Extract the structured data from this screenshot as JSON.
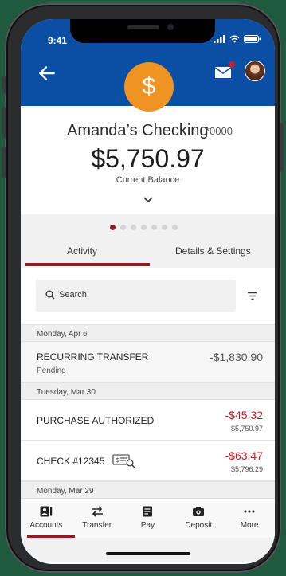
{
  "status": {
    "time": "9:41"
  },
  "account": {
    "name": "Amanda’s Checking",
    "number": "*0000",
    "balance": "$5,750.97",
    "balance_label": "Current Balance"
  },
  "pager": {
    "count": 7,
    "active": 0
  },
  "tabs": [
    {
      "label": "Activity",
      "active": true
    },
    {
      "label": "Details & Settings",
      "active": false
    }
  ],
  "search": {
    "placeholder": "Search"
  },
  "dates": [
    "Monday, Apr 6",
    "Tuesday, Mar 30",
    "Monday, Mar 29"
  ],
  "transactions": [
    {
      "title": "RECURRING TRANSFER",
      "status": "Pending",
      "amount": "-$1,830.90",
      "balance": ""
    },
    {
      "title": "PURCHASE AUTHORIZED",
      "status": "",
      "amount": "-$45.32",
      "balance": "$5,750.97"
    },
    {
      "title": "CHECK #12345",
      "status": "",
      "amount": "-$63.47",
      "balance": "$5,796.29"
    }
  ],
  "nav": [
    {
      "label": "Accounts",
      "icon": "accounts-icon",
      "active": true
    },
    {
      "label": "Transfer",
      "icon": "transfer-icon",
      "active": false
    },
    {
      "label": "Pay",
      "icon": "pay-icon",
      "active": false
    },
    {
      "label": "Deposit",
      "icon": "deposit-icon",
      "active": false
    },
    {
      "label": "More",
      "icon": "more-icon",
      "active": false
    }
  ],
  "colors": {
    "brand_blue": "#0b4fa4",
    "accent_red": "#8f1b23",
    "coin_orange": "#ef9322",
    "negative": "#c21b24"
  }
}
